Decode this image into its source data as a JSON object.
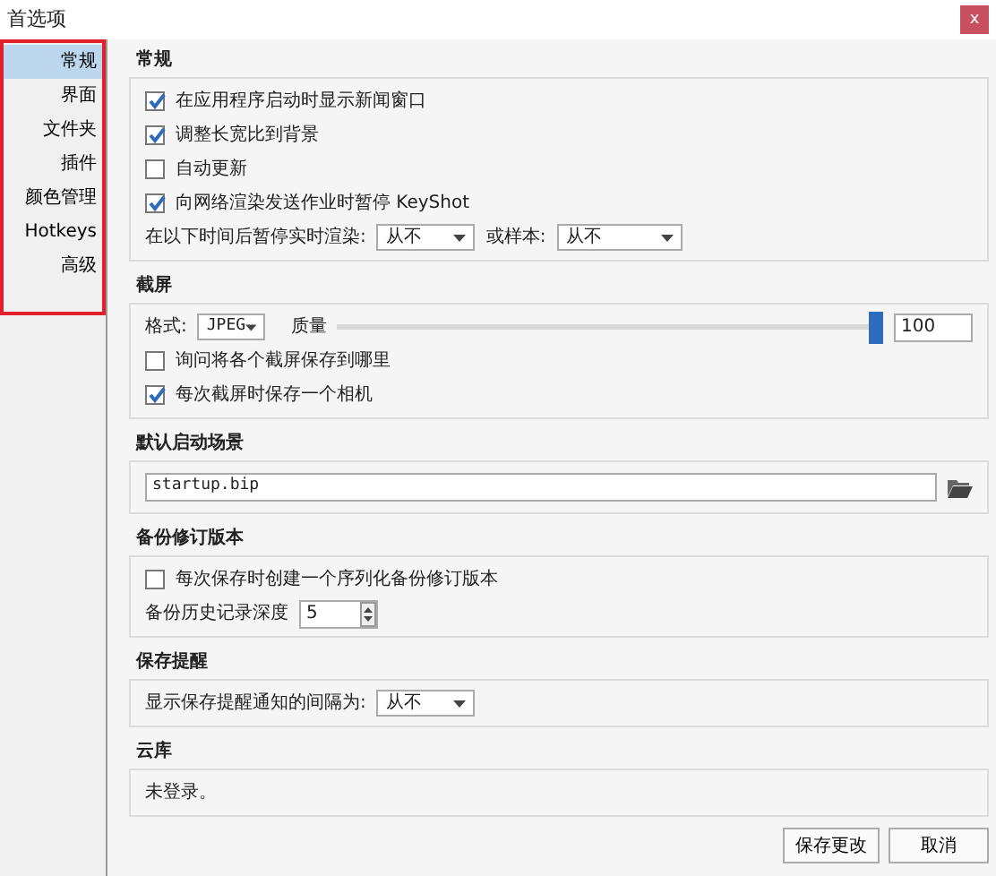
{
  "window": {
    "title": "首选项",
    "close": "x"
  },
  "sidebar": {
    "items": [
      {
        "label": "常规",
        "selected": true
      },
      {
        "label": "界面",
        "selected": false
      },
      {
        "label": "文件夹",
        "selected": false
      },
      {
        "label": "插件",
        "selected": false
      },
      {
        "label": "颜色管理",
        "selected": false
      },
      {
        "label": "Hotkeys",
        "selected": false
      },
      {
        "label": "高级",
        "selected": false
      }
    ]
  },
  "sections": [
    {
      "title": "常规",
      "rows": [
        {
          "kind": "checkbox",
          "label": "在应用程序启动时显示新闻窗口",
          "checked": true
        },
        {
          "kind": "checkbox",
          "label": "调整长宽比到背景",
          "checked": true
        },
        {
          "kind": "checkbox",
          "label": "自动更新",
          "checked": false
        },
        {
          "kind": "checkbox",
          "label": "向网络渲染发送作业时暂停 KeyShot",
          "checked": true
        },
        {
          "kind": "selects",
          "label": "在以下时间后暂停实时渲染:",
          "value": "从不",
          "label2": "或样本:",
          "value2": "从不"
        }
      ]
    },
    {
      "title": "截屏",
      "rows": [
        {
          "kind": "quality",
          "label": "格式:",
          "value": "JPEG",
          "label2": "质量",
          "level": 1,
          "value2": "100"
        },
        {
          "kind": "checkbox",
          "label": "询问将各个截屏保存到哪里",
          "checked": false
        },
        {
          "kind": "checkbox",
          "label": "每次截屏时保存一个相机",
          "checked": true
        }
      ]
    },
    {
      "title": "默认启动场景",
      "rows": [
        {
          "kind": "file",
          "value": "startup.bip"
        }
      ]
    },
    {
      "title": "备份修订版本",
      "rows": [
        {
          "kind": "checkbox",
          "label": "每次保存时创建一个序列化备份修订版本",
          "checked": false
        },
        {
          "kind": "spin",
          "label": "备份历史记录深度",
          "value": "5"
        }
      ]
    },
    {
      "title": "保存提醒",
      "rows": [
        {
          "kind": "selects",
          "label": "显示保存提醒通知的间隔为:",
          "value": "从不"
        }
      ]
    },
    {
      "title": "云库",
      "rows": [
        {
          "kind": "text",
          "label": "未登录。"
        }
      ]
    }
  ],
  "buttons": [
    "保存更改",
    "取消"
  ]
}
